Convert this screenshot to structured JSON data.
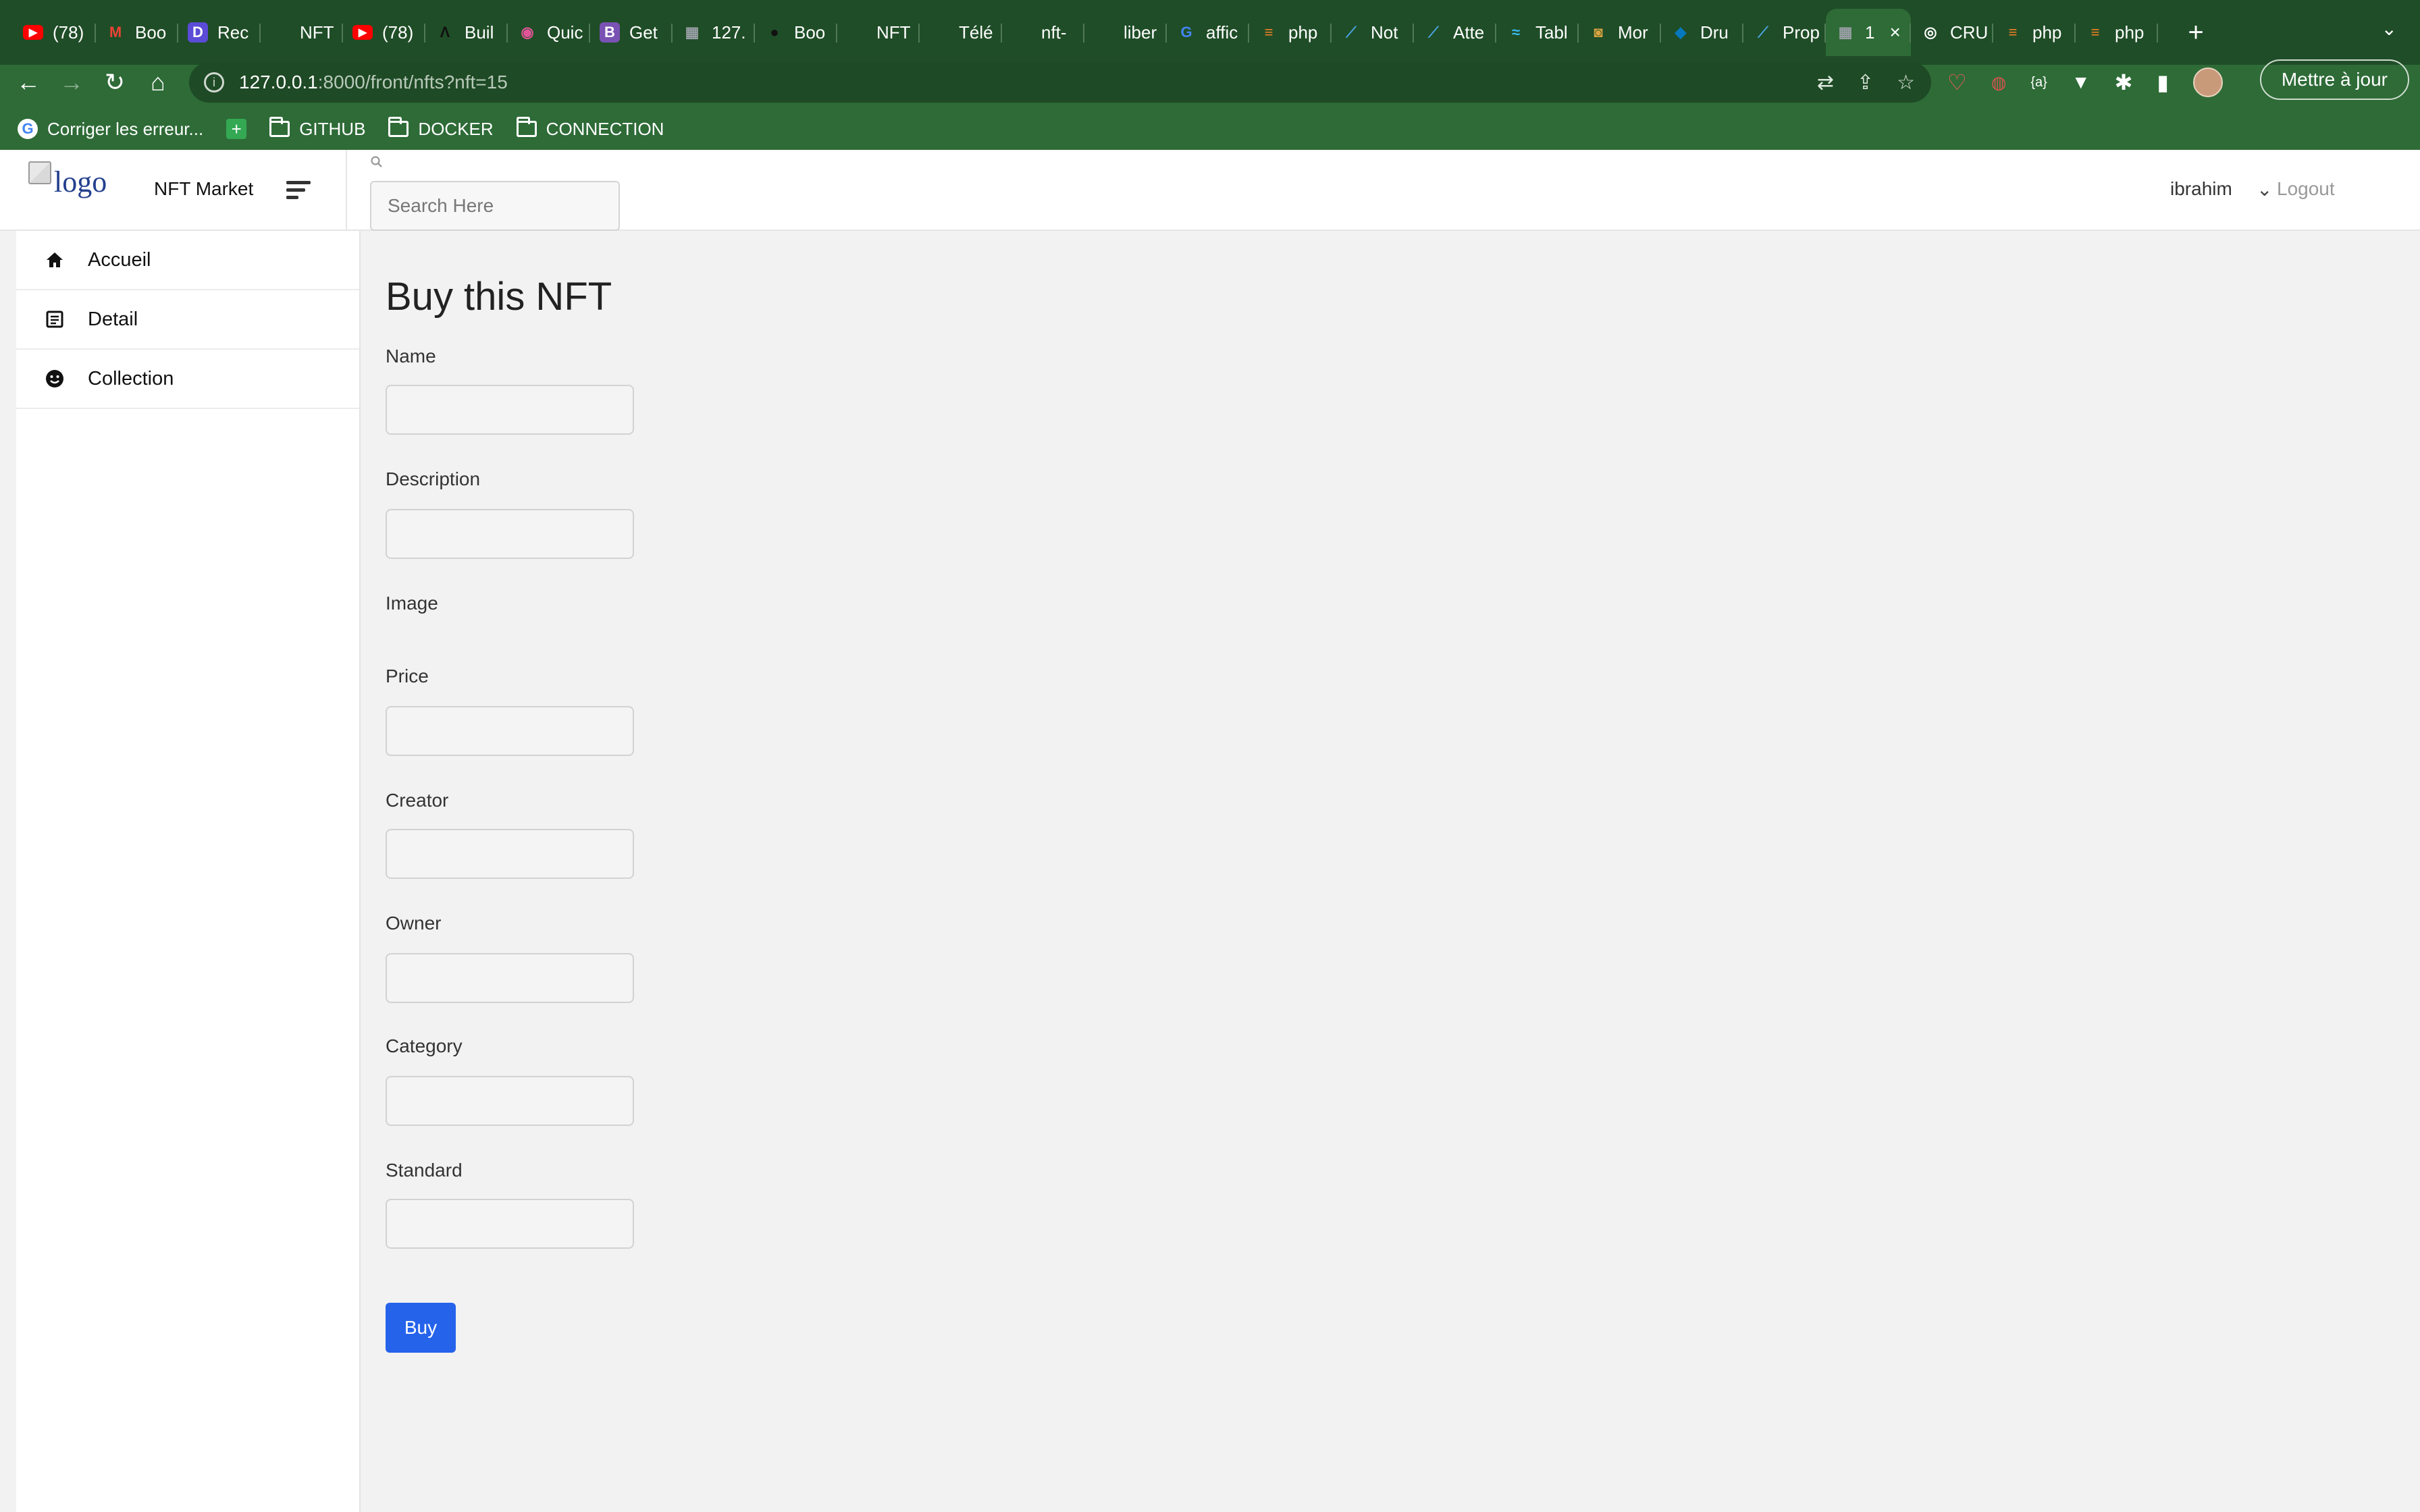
{
  "browser": {
    "tabs": [
      {
        "label": "(78)",
        "icon": "youtube-icon",
        "color": "#ff0000"
      },
      {
        "label": "Boo",
        "icon": "gmail-icon",
        "color": "#ea4335"
      },
      {
        "label": "Rec",
        "icon": "d-app-icon",
        "color": "#5b4bd6"
      },
      {
        "label": "NFT",
        "icon": "github-icon",
        "color": "#1f4d27"
      },
      {
        "label": "(78)",
        "icon": "youtube-icon",
        "color": "#ff0000"
      },
      {
        "label": "Buil",
        "icon": "build-icon",
        "color": "#111111"
      },
      {
        "label": "Quic",
        "icon": "quick-icon",
        "color": "#e05597"
      },
      {
        "label": "Get",
        "icon": "bootstrap-icon",
        "color": "#7952b3"
      },
      {
        "label": "127.",
        "icon": "grid-icon",
        "color": "#9aa0a6"
      },
      {
        "label": "Boo",
        "icon": "github-icon",
        "color": "#111111"
      },
      {
        "label": "NFT",
        "icon": "github-icon",
        "color": "#1f4d27"
      },
      {
        "label": "Télé",
        "icon": "download-icon",
        "color": "#1f4d27"
      },
      {
        "label": "nft-",
        "icon": "github-icon",
        "color": "#1f4d27"
      },
      {
        "label": "liber",
        "icon": "github-icon",
        "color": "#1f4d27"
      },
      {
        "label": "affic",
        "icon": "google-icon",
        "color": "#4285f4"
      },
      {
        "label": "php",
        "icon": "stackoverflow-icon",
        "color": "#f48024"
      },
      {
        "label": "Not",
        "icon": "wand-icon",
        "color": "#4aa3df"
      },
      {
        "label": "Atte",
        "icon": "wand-icon",
        "color": "#4aa3df"
      },
      {
        "label": "Tabl",
        "icon": "tailwind-icon",
        "color": "#38bdf8"
      },
      {
        "label": "Mor",
        "icon": "photo-icon",
        "color": "#d9a441"
      },
      {
        "label": "Dru",
        "icon": "drupal-icon",
        "color": "#0678be"
      },
      {
        "label": "Prop",
        "icon": "wand-icon",
        "color": "#4aa3df"
      },
      {
        "label": "1",
        "icon": "grid-icon",
        "color": "#9aa0a6",
        "active": true
      },
      {
        "label": "CRU",
        "icon": "chat-icon",
        "color": "#ffffff"
      },
      {
        "label": "php",
        "icon": "stackoverflow-icon",
        "color": "#f48024"
      },
      {
        "label": "php",
        "icon": "stackoverflow-icon",
        "color": "#f48024"
      }
    ],
    "url_host": "127.0.0.1",
    "url_path": ":8000/front/nfts?nft=15",
    "update_label": "Mettre à jour",
    "bookmarks": [
      {
        "label": "Corriger les erreur...",
        "icon": "google-icon"
      },
      {
        "label": "",
        "icon": "sheets-icon"
      },
      {
        "label": "GITHUB",
        "icon": "folder-icon"
      },
      {
        "label": "DOCKER",
        "icon": "folder-icon"
      },
      {
        "label": "CONNECTION",
        "icon": "folder-icon"
      }
    ]
  },
  "header": {
    "logo_alt": "logo",
    "brand": "NFT Market",
    "search_placeholder": "Search Here",
    "user": "ibrahim",
    "logout": "Logout"
  },
  "sidebar": {
    "items": [
      {
        "label": "Accueil",
        "icon": "home-icon"
      },
      {
        "label": "Detail",
        "icon": "document-icon"
      },
      {
        "label": "Collection",
        "icon": "smiley-icon"
      }
    ]
  },
  "form": {
    "title": "Buy this NFT",
    "fields": {
      "name": "Name",
      "description": "Description",
      "image": "Image",
      "price": "Price",
      "creator": "Creator",
      "owner": "Owner",
      "category": "Category",
      "standard": "Standard"
    },
    "submit_label": "Buy",
    "accent_color": "#2563eb"
  }
}
